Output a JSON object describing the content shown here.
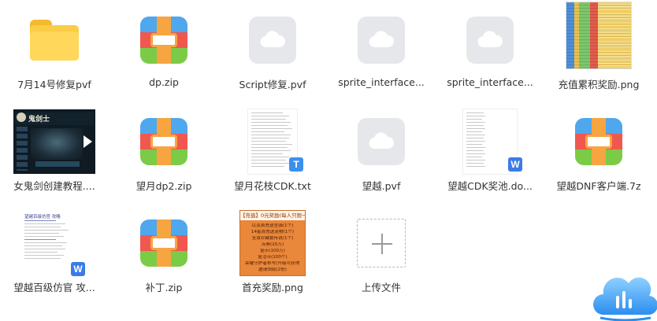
{
  "files": [
    {
      "name": "7月14号修复pvf",
      "type": "folder"
    },
    {
      "name": "dp.zip",
      "type": "zip"
    },
    {
      "name": "Script修复.pvf",
      "type": "cloud-doc"
    },
    {
      "name": "sprite_interface...",
      "type": "cloud-doc"
    },
    {
      "name": "sprite_interface...",
      "type": "cloud-doc"
    },
    {
      "name": "充值累积奖励.png",
      "type": "spreadsheet-image"
    },
    {
      "name": "女鬼剑创建教程....",
      "type": "video-thumbnail",
      "thumb_text": "鬼剑士"
    },
    {
      "name": "望月dp2.zip",
      "type": "zip"
    },
    {
      "name": "望月花枝CDK.txt",
      "type": "text-doc",
      "badge": "T"
    },
    {
      "name": "望越.pvf",
      "type": "cloud-doc"
    },
    {
      "name": "望越CDK奖池.do...",
      "type": "word-doc",
      "badge": "W"
    },
    {
      "name": "望越DNF客户端.7z",
      "type": "zip"
    },
    {
      "name": "望越百级仿官 攻...",
      "type": "word-doc",
      "badge": "W",
      "thumb_title": "望越百级仿官 攻略"
    },
    {
      "name": "补丁.zip",
      "type": "zip"
    },
    {
      "name": "首充奖励.png",
      "type": "poster-image"
    },
    {
      "name": "上传文件",
      "type": "upload"
    }
  ],
  "poster": {
    "head": "【充值】0元奖励(每人只限一次)",
    "lines": [
      "以及首充送坐骑(1个)",
      "14星首充送宠物(1个)",
      "至尊珍藏套传说(1个)",
      "点券(20万)",
      "金币(100万)",
      "复活币(100个)",
      "荣耀守护者称号(升级可获得)",
      "邀请领取(2份)"
    ]
  },
  "colors": {
    "zip_blue": "#4fa7ee",
    "zip_red": "#f0584f",
    "zip_green": "#7bcb47",
    "zip_strap": "#f7a541",
    "folder": "#ffd75a",
    "cloud_bg": "#e5e7ea",
    "badge_blue": "#3d8fee",
    "poster": "#e9873a"
  }
}
